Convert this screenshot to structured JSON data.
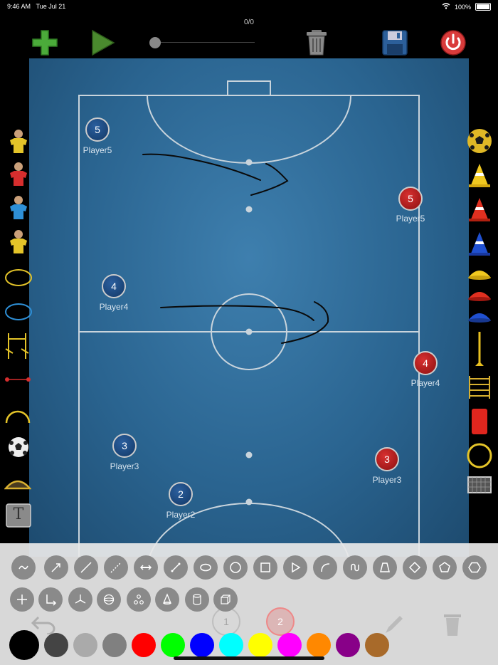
{
  "status": {
    "time": "9:46 AM",
    "date": "Tue Jul 21",
    "battery": "100%"
  },
  "toolbar": {
    "counter": "0/0",
    "add_color": "#4bab3a",
    "play_color": "#4a8a2e",
    "power_color": "#d93b3b",
    "save_color": "#2c5f9a"
  },
  "players": {
    "blue": [
      {
        "number": "5",
        "label": "Player5"
      },
      {
        "number": "4",
        "label": "Player4"
      },
      {
        "number": "3",
        "label": "Player3"
      },
      {
        "number": "2",
        "label": "Player2"
      }
    ],
    "red": [
      {
        "number": "5",
        "label": "Player5"
      },
      {
        "number": "4",
        "label": "Player4"
      },
      {
        "number": "3",
        "label": "Player3"
      }
    ],
    "hidden_markers": [
      "1",
      "2"
    ]
  },
  "left_tools": {
    "text_tool_label": "T",
    "player_shirts": [
      "#e4c429",
      "#d62e2e",
      "#2e8fd6",
      "#e4c429"
    ]
  },
  "colors": [
    "#000000",
    "#444444",
    "#aaaaaa",
    "#808080",
    "#ff0000",
    "#00ff00",
    "#0000ff",
    "#00ffff",
    "#ffff00",
    "#ff00ff",
    "#ff8800",
    "#880088",
    "#a86a2a"
  ]
}
